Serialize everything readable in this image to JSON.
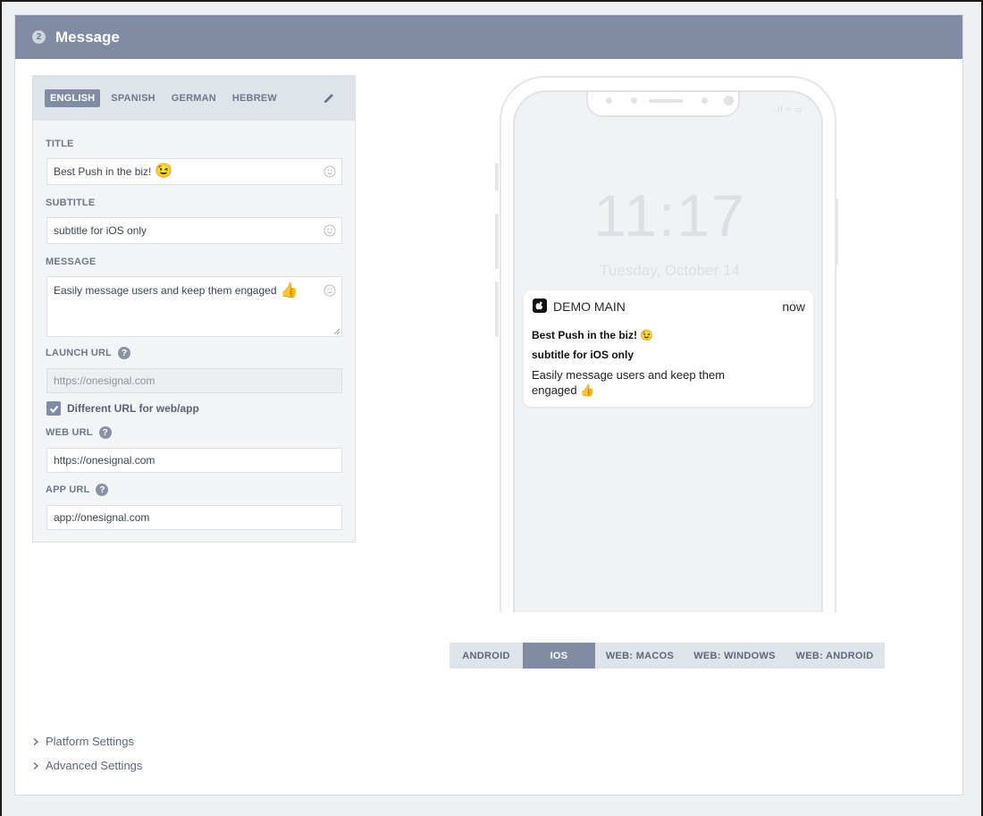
{
  "section": {
    "step_number": "2",
    "title": "Message"
  },
  "languages": {
    "tabs": [
      "ENGLISH",
      "SPANISH",
      "GERMAN",
      "HEBREW"
    ],
    "active": "ENGLISH"
  },
  "form": {
    "title_label": "TITLE",
    "title_value": "Best Push in the biz!",
    "title_emoji": "😉",
    "subtitle_label": "SUBTITLE",
    "subtitle_value": "subtitle for iOS only",
    "message_label": "MESSAGE",
    "message_value": "Easily message users and keep them engaged",
    "message_emoji": "👍",
    "launch_url_label": "LAUNCH URL",
    "launch_url_placeholder": "https://onesignal.com",
    "checkbox_label": "Different URL for web/app",
    "checkbox_checked": true,
    "web_url_label": "WEB URL",
    "web_url_value": "https://onesignal.com",
    "app_url_label": "APP URL",
    "app_url_value": "app://onesignal.com",
    "help_glyph": "?"
  },
  "preview": {
    "clock": "11:17",
    "date": "Tuesday, October 14",
    "app_name": "DEMO MAIN",
    "time": "now",
    "title": "Best Push in the biz!",
    "title_emoji": "😉",
    "subtitle": "subtitle for iOS only",
    "body": "Easily message users and keep them engaged",
    "body_emoji": "👍",
    "status_icons": "..ıl ≈ ▭"
  },
  "platforms": {
    "tabs": [
      "ANDROID",
      "IOS",
      "WEB: MACOS",
      "WEB: WINDOWS",
      "WEB: ANDROID"
    ],
    "active": "IOS"
  },
  "settings": {
    "platform_settings": "Platform Settings",
    "advanced_settings": "Advanced Settings"
  },
  "colors": {
    "header_bg": "#7f8ca3",
    "accent": "#7f8ca3",
    "panel_bg": "#f3f4f6"
  }
}
